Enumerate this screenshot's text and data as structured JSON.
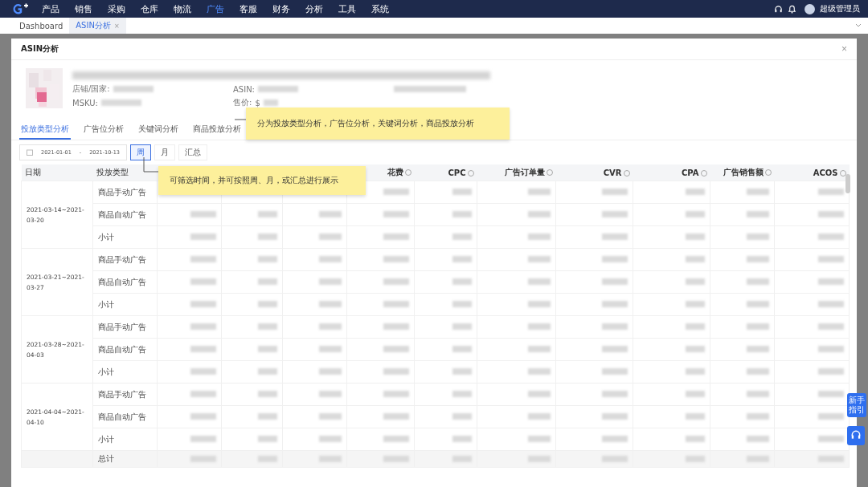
{
  "nav": {
    "items": [
      {
        "label": "产品",
        "selected": false
      },
      {
        "label": "销售",
        "selected": false
      },
      {
        "label": "采购",
        "selected": false
      },
      {
        "label": "仓库",
        "selected": false
      },
      {
        "label": "物流",
        "selected": false
      },
      {
        "label": "广告",
        "selected": true
      },
      {
        "label": "客服",
        "selected": false
      },
      {
        "label": "财务",
        "selected": false
      },
      {
        "label": "分析",
        "selected": false
      },
      {
        "label": "工具",
        "selected": false
      },
      {
        "label": "系统",
        "selected": false
      }
    ],
    "user": "超级管理员"
  },
  "page_tabs": [
    {
      "label": "Dashboard",
      "selected": false,
      "closable": false
    },
    {
      "label": "ASIN分析",
      "selected": true,
      "closable": true
    }
  ],
  "close_glyph": "×",
  "dialog": {
    "title": "ASIN分析",
    "close": "×",
    "product": {
      "fields": [
        {
          "label": "店铺/国家:"
        },
        {
          "label": "ASIN:"
        },
        {
          "label": "MSKU:"
        },
        {
          "label": "售价:",
          "prefix": "$"
        }
      ]
    },
    "tabs": [
      {
        "label": "投放类型分析",
        "selected": true
      },
      {
        "label": "广告位分析",
        "selected": false
      },
      {
        "label": "关键词分析",
        "selected": false
      },
      {
        "label": "商品投放分析",
        "selected": false
      }
    ],
    "date_range": {
      "start": "2021-01-01",
      "separator": "-",
      "end": "2021-10-13"
    },
    "periods": [
      {
        "label": "周",
        "selected": true
      },
      {
        "label": "月",
        "selected": false
      },
      {
        "label": "汇总",
        "selected": false
      }
    ],
    "table": {
      "columns": [
        {
          "label": "日期",
          "kind": "text"
        },
        {
          "label": "投放类型",
          "kind": "text"
        },
        {
          "kind": "hidden"
        },
        {
          "kind": "hidden"
        },
        {
          "kind": "hidden"
        },
        {
          "label": "花费",
          "kind": "metric"
        },
        {
          "label": "CPC",
          "kind": "metric"
        },
        {
          "label": "广告订单量",
          "kind": "metric"
        },
        {
          "label": "CVR",
          "kind": "metric"
        },
        {
          "label": "CPA",
          "kind": "metric"
        },
        {
          "label": "广告销售额",
          "kind": "metric"
        },
        {
          "label": "ACOS",
          "kind": "metric"
        }
      ],
      "groups": [
        {
          "date": "2021-03-14~2021-03-20",
          "rows": [
            "商品手动广告",
            "商品自动广告",
            "小计"
          ]
        },
        {
          "date": "2021-03-21~2021-03-27",
          "rows": [
            "商品手动广告",
            "商品自动广告",
            "小计"
          ]
        },
        {
          "date": "2021-03-28~2021-04-03",
          "rows": [
            "商品手动广告",
            "商品自动广告",
            "小计"
          ]
        },
        {
          "date": "2021-04-04~2021-04-10",
          "rows": [
            "商品手动广告",
            "商品自动广告",
            "小计"
          ]
        }
      ],
      "total": "总计"
    }
  },
  "callouts": [
    {
      "text": "分为投放类型分析，广告位分析，关键词分析，商品投放分析"
    },
    {
      "text": "可筛选时间，并可按照周、月，或汇总进行展示"
    }
  ],
  "guide_button": "新手指引"
}
